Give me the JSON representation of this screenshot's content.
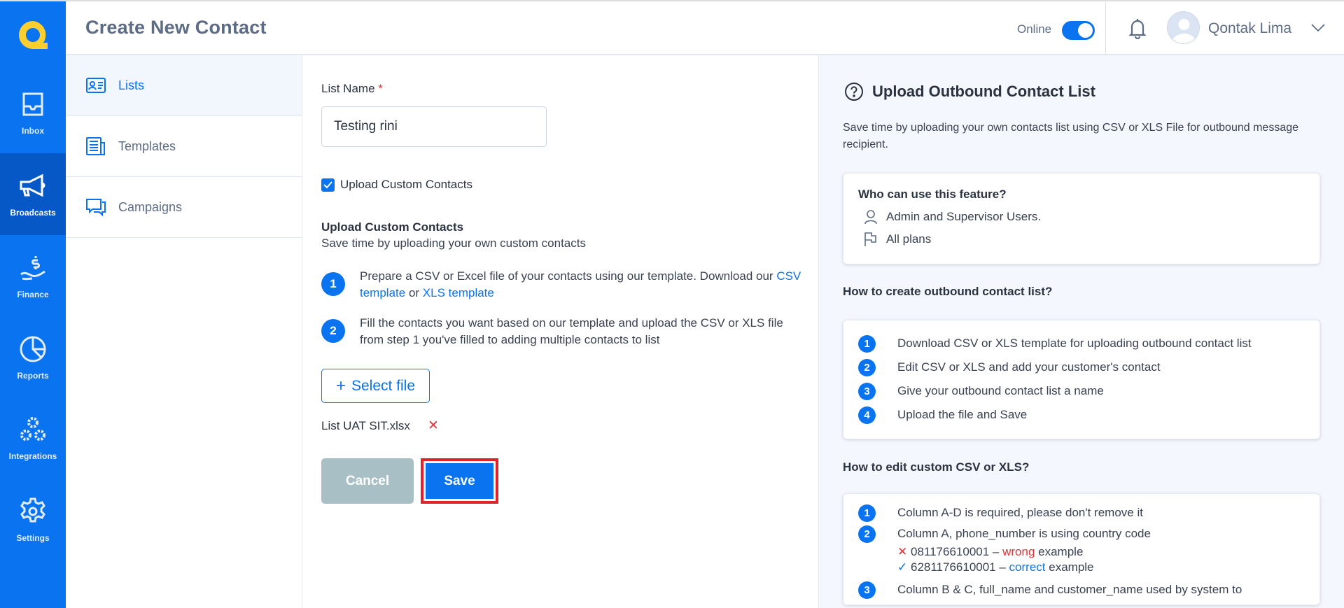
{
  "colors": {
    "brand": "#0a73ef",
    "brand_active": "#0558c6",
    "logo": "#fccf2f",
    "danger": "#e0343a"
  },
  "sidebar": {
    "logo": "qontak-logo",
    "items": [
      {
        "label": "Inbox",
        "icon": "inbox-icon"
      },
      {
        "label": "Broadcasts",
        "icon": "megaphone-icon",
        "active": true
      },
      {
        "label": "Finance",
        "icon": "finance-icon"
      },
      {
        "label": "Reports",
        "icon": "pie-chart-icon"
      },
      {
        "label": "Integrations",
        "icon": "integrations-icon"
      },
      {
        "label": "Settings",
        "icon": "gear-icon"
      }
    ]
  },
  "header": {
    "title": "Create New Contact",
    "status_label": "Online",
    "status_on": true,
    "user_name": "Qontak Lima"
  },
  "subnav": {
    "items": [
      {
        "label": "Lists",
        "active": true
      },
      {
        "label": "Templates"
      },
      {
        "label": "Campaigns"
      }
    ]
  },
  "form": {
    "list_name_label": "List Name",
    "required_mark": "*",
    "list_name_value": "Testing rini",
    "upload_checkbox_label": "Upload Custom Contacts",
    "upload_checked": true,
    "section_title": "Upload Custom Contacts",
    "section_subtitle": "Save time by uploading your own custom contacts",
    "step1": {
      "num": "1",
      "text": "Prepare a CSV or Excel file of your contacts using our template. Download our",
      "csv_link": "CSV template",
      "or": "or",
      "xls_link": "XLS template"
    },
    "step2": {
      "num": "2",
      "text": "Fill the contacts you want based on our template and upload the CSV or XLS file from step 1 you've filled to adding multiple contacts to list"
    },
    "select_file_label": "Select file",
    "file_name": "List UAT SIT.xlsx",
    "cancel_label": "Cancel",
    "save_label": "Save"
  },
  "help": {
    "title": "Upload Outbound Contact List",
    "description": "Save time by uploading your own contacts list using CSV or XLS File for outbound message recipient.",
    "who_title": "Who can use this feature?",
    "who_users": "Admin and Supervisor Users.",
    "who_plans": "All plans",
    "create_title": "How to create outbound contact list?",
    "create_steps": [
      "Download CSV or XLS template for uploading outbound contact list",
      "Edit CSV or XLS and add your customer's contact",
      "Give your outbound contact list a name",
      "Upload the file and Save"
    ],
    "edit_title": "How to edit custom CSV or XLS?",
    "edit_steps": [
      "Column A-D is required, please don't remove it",
      "Column A, phone_number is using country code",
      "Column B & C, full_name and customer_name used by system to"
    ],
    "wrong_example": {
      "number": "081176610001 –",
      "word": "wrong",
      "suffix": "example"
    },
    "correct_example": {
      "number": "6281176610001 –",
      "word": "correct",
      "suffix": "example"
    }
  }
}
